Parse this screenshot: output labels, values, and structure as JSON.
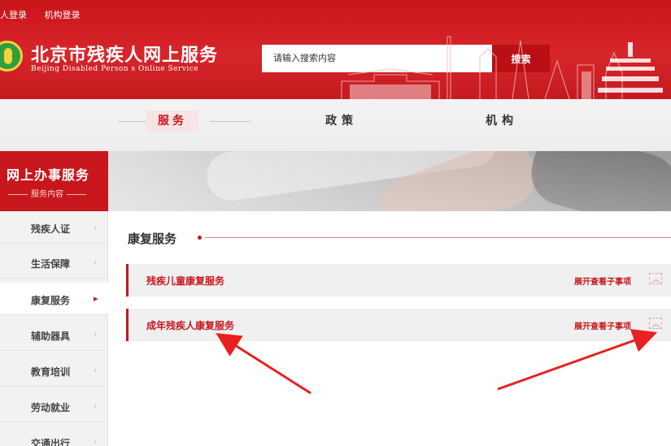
{
  "topbar": {
    "personal_login": "人登录",
    "org_login": "机构登录"
  },
  "site": {
    "title": "北京市残疾人网上服务",
    "subtitle": "Beijing Disabled Person s Online Service"
  },
  "search": {
    "placeholder": "请输入搜索内容",
    "button": "搜索"
  },
  "nav": {
    "items": [
      "服务",
      "政策",
      "机构"
    ],
    "active": "服务"
  },
  "sidebar": {
    "title": "网上办事服务",
    "subtitle": "服务内容",
    "items": [
      {
        "label": "残疾人证"
      },
      {
        "label": "生活保障"
      },
      {
        "label": "康复服务"
      },
      {
        "label": "辅助器具"
      },
      {
        "label": "教育培训"
      },
      {
        "label": "劳动就业"
      },
      {
        "label": "交通出行"
      }
    ],
    "active": "康复服务"
  },
  "content": {
    "section_title": "康复服务",
    "services": [
      {
        "title": "残疾儿童康复服务",
        "expand_label": "展开查看子事项"
      },
      {
        "title": "成年残疾人康复服务",
        "expand_label": "展开查看子事项"
      }
    ]
  },
  "icons": {
    "chevron": "chevron-right-icon",
    "expand": "chevron-up-icon"
  },
  "colors": {
    "brand_red": "#c8161d",
    "header_red": "#d7262b",
    "sidebar_bg": "#f2f2f2",
    "row_bg": "#f0f0f0"
  }
}
